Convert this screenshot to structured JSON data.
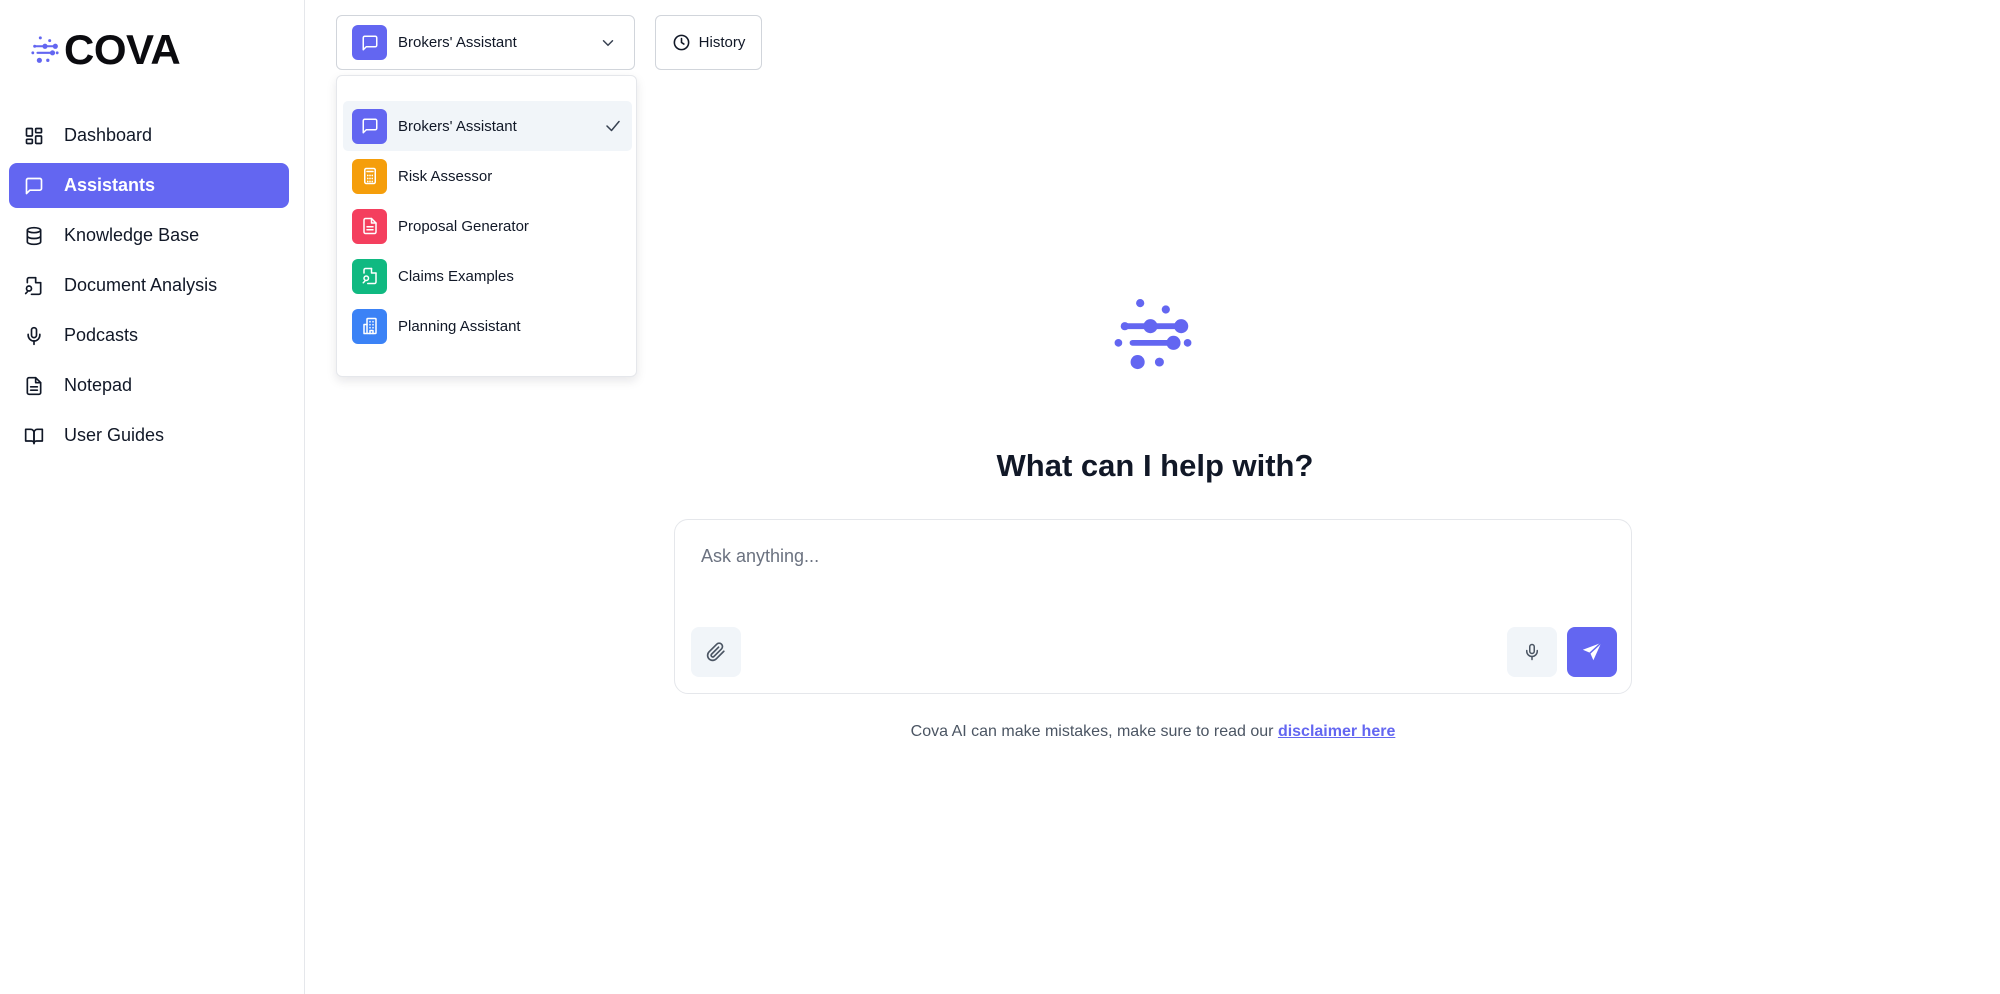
{
  "brand": {
    "name": "COVA",
    "accent": "#6366f1"
  },
  "sidebar": {
    "items": [
      {
        "label": "Dashboard",
        "icon": "dashboard-grid-icon",
        "active": false
      },
      {
        "label": "Assistants",
        "icon": "chat-bubble-icon",
        "active": true
      },
      {
        "label": "Knowledge Base",
        "icon": "database-icon",
        "active": false
      },
      {
        "label": "Document Analysis",
        "icon": "document-search-icon",
        "active": false
      },
      {
        "label": "Podcasts",
        "icon": "microphone-icon",
        "active": false
      },
      {
        "label": "Notepad",
        "icon": "notepad-icon",
        "active": false
      },
      {
        "label": "User Guides",
        "icon": "book-open-icon",
        "active": false
      }
    ]
  },
  "header": {
    "selected_assistant": "Brokers' Assistant",
    "history_label": "History"
  },
  "dropdown": {
    "items": [
      {
        "label": "Brokers' Assistant",
        "icon": "chat-bubble-icon",
        "color": "#6366f1",
        "selected": true
      },
      {
        "label": "Risk Assessor",
        "icon": "calculator-icon",
        "color": "#f59e0b",
        "selected": false
      },
      {
        "label": "Proposal Generator",
        "icon": "file-text-icon",
        "color": "#f43f5e",
        "selected": false
      },
      {
        "label": "Claims Examples",
        "icon": "file-search-icon",
        "color": "#10b981",
        "selected": false
      },
      {
        "label": "Planning Assistant",
        "icon": "building-icon",
        "color": "#3b82f6",
        "selected": false
      }
    ]
  },
  "main": {
    "headline": "What can I help with?",
    "input_placeholder": "Ask anything...",
    "disclaimer_text": "Cova AI can make mistakes, make sure to read our ",
    "disclaimer_link": "disclaimer here"
  }
}
